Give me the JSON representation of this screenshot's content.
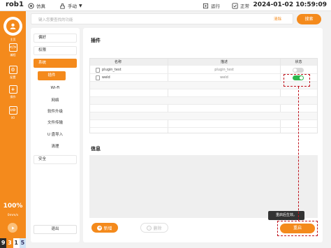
{
  "header": {
    "robot_name": "rob1",
    "sim_label": "仿真",
    "mode_label": "手动",
    "run_label": "运行",
    "status_label": "正常",
    "datetime": "2024-01-02 10:59:09"
  },
  "sidebar": {
    "home_label": "主页",
    "items": [
      {
        "label": "编程",
        "icon": "code-icon",
        "glyph": "</>"
      },
      {
        "label": "配置",
        "icon": "settings-icon",
        "glyph": "⚙"
      },
      {
        "label": "操作",
        "icon": "plus-icon",
        "glyph": "+"
      },
      {
        "label": "I/O",
        "icon": "io-icon",
        "glyph": "I/O"
      }
    ],
    "speed": "100%",
    "speed_unit": "0mm/s",
    "status_digits": [
      "9",
      "3",
      "1",
      "5"
    ]
  },
  "search": {
    "placeholder": "键入您要查找的功能",
    "clear_label": "清除",
    "search_label": "搜索"
  },
  "menu": {
    "items": [
      {
        "label": "偏好"
      },
      {
        "label": "权限"
      },
      {
        "label": "系统"
      }
    ],
    "sub_items": [
      {
        "label": "插件"
      },
      {
        "label": "Wi-Fi"
      },
      {
        "label": "网络"
      },
      {
        "label": "软件升级"
      },
      {
        "label": "文件传输"
      },
      {
        "label": "U 盘导入"
      },
      {
        "label": "清理"
      }
    ],
    "security_label": "安全",
    "logout_label": "退出"
  },
  "plugins": {
    "title": "插件",
    "columns": [
      "名称",
      "描述",
      "状态"
    ],
    "rows": [
      {
        "name": "plugin_test",
        "desc": "plugin_test",
        "enabled": false
      },
      {
        "name": "weld",
        "desc": "weld",
        "enabled": true
      }
    ]
  },
  "info": {
    "title": "信息"
  },
  "actions": {
    "add_label": "新增",
    "delete_label": "删除",
    "restart_label": "重启",
    "tooltip": "重启后生效。"
  },
  "colors": {
    "accent": "#f48a1c",
    "toggle_on": "#2db84d",
    "annotation": "#c0131d"
  }
}
